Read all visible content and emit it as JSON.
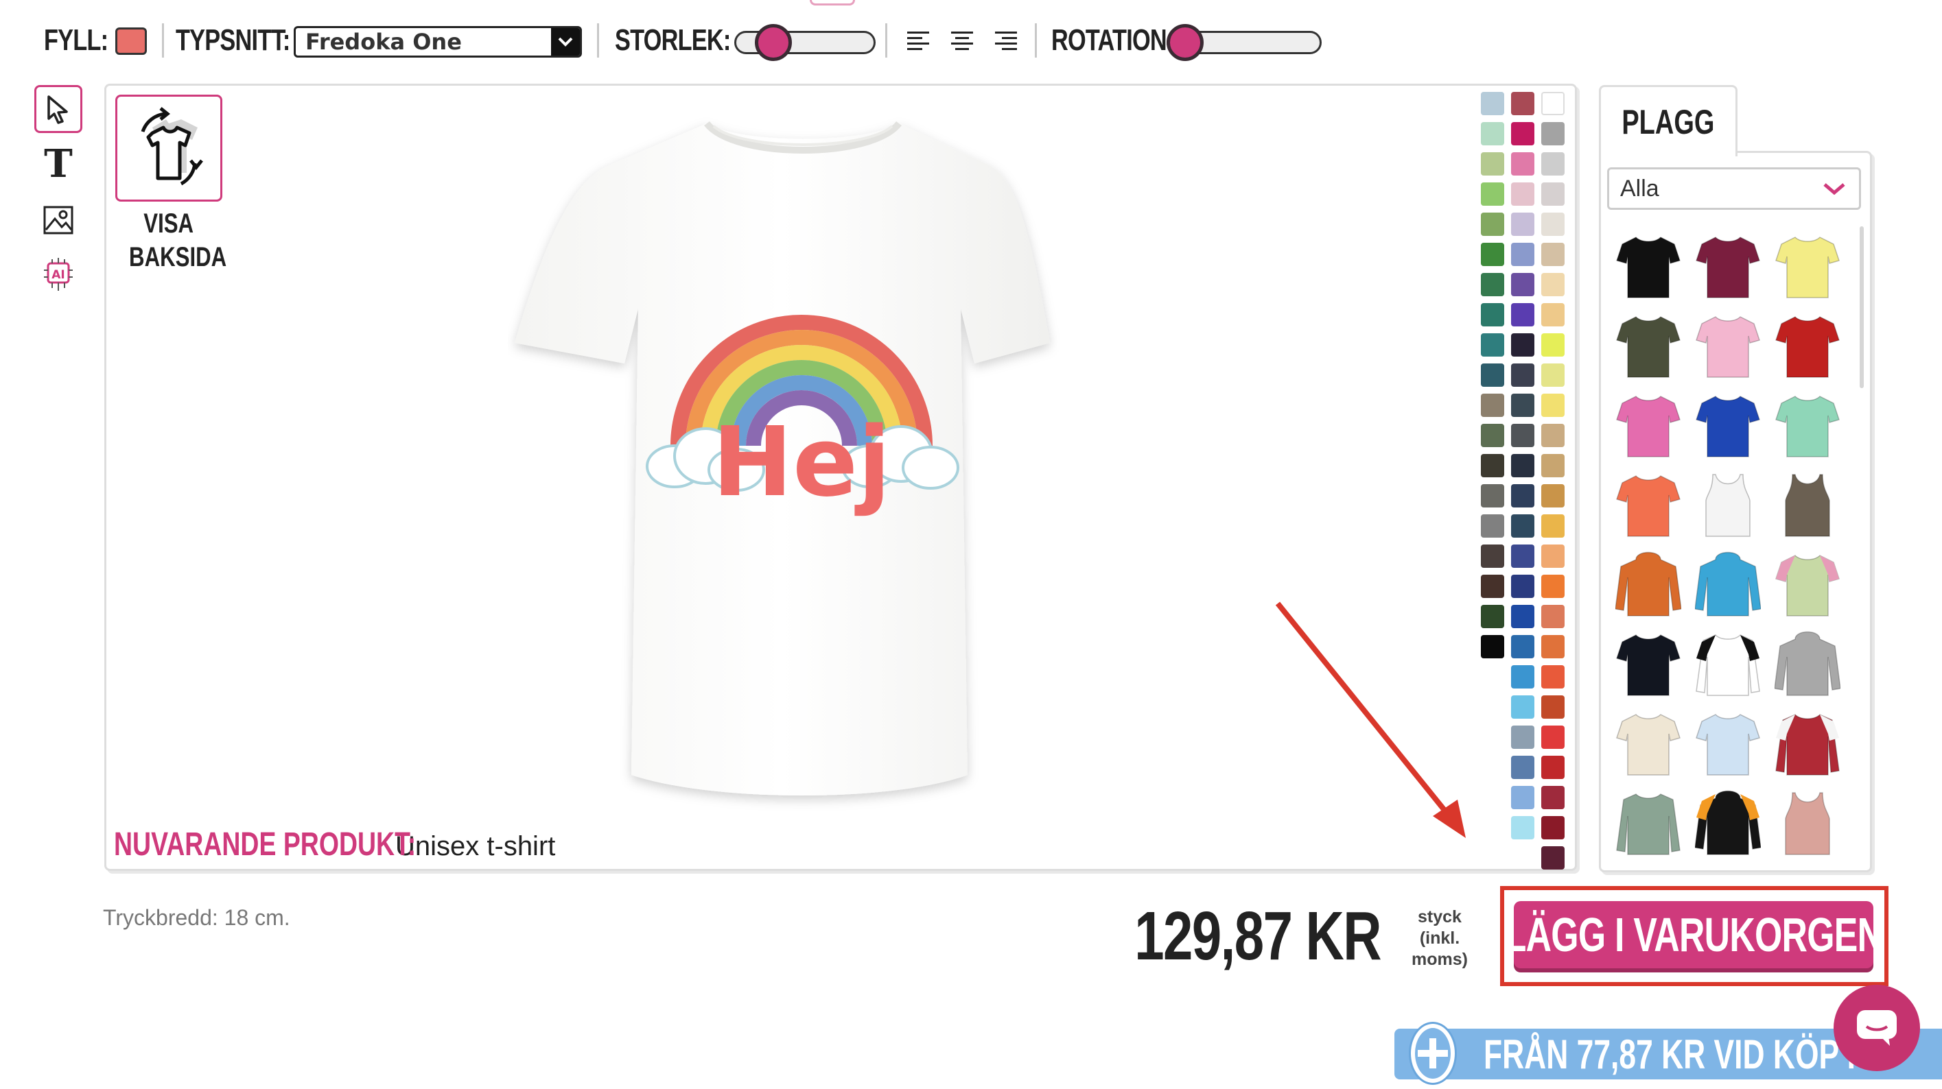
{
  "toolbar": {
    "fill_label": "FYLL:",
    "fill_color": "#e8706a",
    "font_label": "TYPSNITT:",
    "font_value": "Fredoka One",
    "size_label": "STORLEK:",
    "size_level": 0.2,
    "rotation_label": "ROTATION:",
    "rotation_level": 0.0,
    "align_icons": [
      "align-left-icon",
      "align-center-icon",
      "align-right-icon"
    ]
  },
  "tools": [
    "select-cursor-icon",
    "text-tool-icon",
    "image-tool-icon",
    "ai-tool-icon"
  ],
  "canvas": {
    "back_button_label_1": "VISA",
    "back_button_label_2": "BAKSIDA",
    "design_text": "Hej",
    "current_product_label": "NUVARANDE PRODUKT:",
    "current_product_value": "Unisex t-shirt"
  },
  "colors": {
    "col1": [
      "#b5cbd9",
      "#b3dcc4",
      "#b4c98f",
      "#8fc96b",
      "#82a860",
      "#3e8a3a",
      "#357a4e",
      "#2c7a6a",
      "#2f7e7e",
      "#2e5d6b",
      "#8c7f6c",
      "#5c6e52",
      "#3d3a30",
      "#6a6a64",
      "#808080",
      "#4a3f3c",
      "#46312a",
      "#2e4a29",
      "#0a0a0a"
    ],
    "col2": [
      "#a84a55",
      "#c2195f",
      "#e07aa8",
      "#e5c2cc",
      "#c7bed9",
      "#8a9acc",
      "#6b4fa0",
      "#5a3db0",
      "#272235",
      "#3c4050",
      "#3a4a55",
      "#505458",
      "#283040",
      "#2e3f5c",
      "#2e4a60",
      "#3c4a90",
      "#2a3b80",
      "#1e4aa3",
      "#2a6aab",
      "#3b95d0",
      "#6cc2e6",
      "#8d9fb0",
      "#5a7dab",
      "#86aede",
      "#a6e0f0"
    ],
    "col3": [
      "#ffffff",
      "#a3a3a3",
      "#cdcdcd",
      "#d6d0d0",
      "#e5e0d8",
      "#d4c0a4",
      "#f0d8ac",
      "#eec98a",
      "#e5ee58",
      "#e4e48a",
      "#f2e070",
      "#c9ab82",
      "#c8a570",
      "#c99449",
      "#eab54a",
      "#f0a870",
      "#ee7a30",
      "#dc7a5a",
      "#e0723a",
      "#e85a3a",
      "#c24a28",
      "#e03a3a",
      "#c0282a",
      "#9e2a3c",
      "#8a1a28",
      "#5a2034"
    ]
  },
  "garments_panel": {
    "tab_label": "PLAGG",
    "filter_value": "Alla",
    "items": [
      "black-tshirt",
      "maroon-tshirt",
      "yellow-tshirt",
      "olive-tshirt",
      "pink-tshirt",
      "red-tshirt",
      "pink-womens-tshirt",
      "blue-tshirt",
      "mint-tshirt",
      "coral-womens-tshirt",
      "white-tanktop",
      "olive-tanktop",
      "orange-hoodie",
      "cyan-hoodie",
      "tiedye-tshirt",
      "black-vneck",
      "raglan-baseball-tee",
      "grey-hoodie",
      "cream-tshirt",
      "lightblue-tshirt",
      "varsity-jacket",
      "green-longsleeve",
      "black-orange-hoodie",
      "rose-tanktop"
    ]
  },
  "footer": {
    "print_width": "Tryckbredd: 18 cm.",
    "price": "129,87 KR",
    "price_note_1": "styck",
    "price_note_2": "(inkl.",
    "price_note_3": "moms)",
    "add_to_cart": "LÄGG I VARUKORGEN",
    "promo": "FRÅN 77,87 KR VID KÖP I"
  }
}
